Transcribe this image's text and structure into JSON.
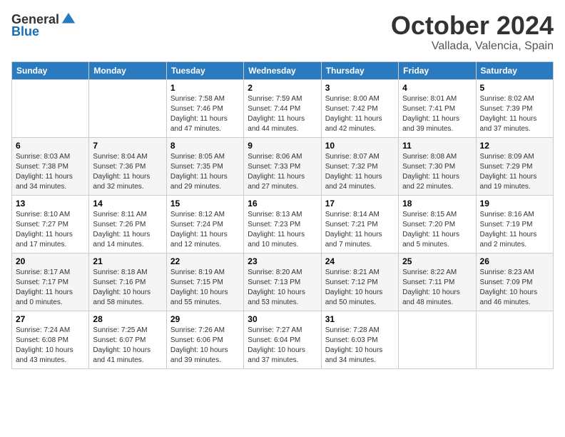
{
  "header": {
    "logo_general": "General",
    "logo_blue": "Blue",
    "month": "October 2024",
    "location": "Vallada, Valencia, Spain"
  },
  "days_of_week": [
    "Sunday",
    "Monday",
    "Tuesday",
    "Wednesday",
    "Thursday",
    "Friday",
    "Saturday"
  ],
  "weeks": [
    [
      {
        "day": "",
        "info": ""
      },
      {
        "day": "",
        "info": ""
      },
      {
        "day": "1",
        "info": "Sunrise: 7:58 AM\nSunset: 7:46 PM\nDaylight: 11 hours and 47 minutes."
      },
      {
        "day": "2",
        "info": "Sunrise: 7:59 AM\nSunset: 7:44 PM\nDaylight: 11 hours and 44 minutes."
      },
      {
        "day": "3",
        "info": "Sunrise: 8:00 AM\nSunset: 7:42 PM\nDaylight: 11 hours and 42 minutes."
      },
      {
        "day": "4",
        "info": "Sunrise: 8:01 AM\nSunset: 7:41 PM\nDaylight: 11 hours and 39 minutes."
      },
      {
        "day": "5",
        "info": "Sunrise: 8:02 AM\nSunset: 7:39 PM\nDaylight: 11 hours and 37 minutes."
      }
    ],
    [
      {
        "day": "6",
        "info": "Sunrise: 8:03 AM\nSunset: 7:38 PM\nDaylight: 11 hours and 34 minutes."
      },
      {
        "day": "7",
        "info": "Sunrise: 8:04 AM\nSunset: 7:36 PM\nDaylight: 11 hours and 32 minutes."
      },
      {
        "day": "8",
        "info": "Sunrise: 8:05 AM\nSunset: 7:35 PM\nDaylight: 11 hours and 29 minutes."
      },
      {
        "day": "9",
        "info": "Sunrise: 8:06 AM\nSunset: 7:33 PM\nDaylight: 11 hours and 27 minutes."
      },
      {
        "day": "10",
        "info": "Sunrise: 8:07 AM\nSunset: 7:32 PM\nDaylight: 11 hours and 24 minutes."
      },
      {
        "day": "11",
        "info": "Sunrise: 8:08 AM\nSunset: 7:30 PM\nDaylight: 11 hours and 22 minutes."
      },
      {
        "day": "12",
        "info": "Sunrise: 8:09 AM\nSunset: 7:29 PM\nDaylight: 11 hours and 19 minutes."
      }
    ],
    [
      {
        "day": "13",
        "info": "Sunrise: 8:10 AM\nSunset: 7:27 PM\nDaylight: 11 hours and 17 minutes."
      },
      {
        "day": "14",
        "info": "Sunrise: 8:11 AM\nSunset: 7:26 PM\nDaylight: 11 hours and 14 minutes."
      },
      {
        "day": "15",
        "info": "Sunrise: 8:12 AM\nSunset: 7:24 PM\nDaylight: 11 hours and 12 minutes."
      },
      {
        "day": "16",
        "info": "Sunrise: 8:13 AM\nSunset: 7:23 PM\nDaylight: 11 hours and 10 minutes."
      },
      {
        "day": "17",
        "info": "Sunrise: 8:14 AM\nSunset: 7:21 PM\nDaylight: 11 hours and 7 minutes."
      },
      {
        "day": "18",
        "info": "Sunrise: 8:15 AM\nSunset: 7:20 PM\nDaylight: 11 hours and 5 minutes."
      },
      {
        "day": "19",
        "info": "Sunrise: 8:16 AM\nSunset: 7:19 PM\nDaylight: 11 hours and 2 minutes."
      }
    ],
    [
      {
        "day": "20",
        "info": "Sunrise: 8:17 AM\nSunset: 7:17 PM\nDaylight: 11 hours and 0 minutes."
      },
      {
        "day": "21",
        "info": "Sunrise: 8:18 AM\nSunset: 7:16 PM\nDaylight: 10 hours and 58 minutes."
      },
      {
        "day": "22",
        "info": "Sunrise: 8:19 AM\nSunset: 7:15 PM\nDaylight: 10 hours and 55 minutes."
      },
      {
        "day": "23",
        "info": "Sunrise: 8:20 AM\nSunset: 7:13 PM\nDaylight: 10 hours and 53 minutes."
      },
      {
        "day": "24",
        "info": "Sunrise: 8:21 AM\nSunset: 7:12 PM\nDaylight: 10 hours and 50 minutes."
      },
      {
        "day": "25",
        "info": "Sunrise: 8:22 AM\nSunset: 7:11 PM\nDaylight: 10 hours and 48 minutes."
      },
      {
        "day": "26",
        "info": "Sunrise: 8:23 AM\nSunset: 7:09 PM\nDaylight: 10 hours and 46 minutes."
      }
    ],
    [
      {
        "day": "27",
        "info": "Sunrise: 7:24 AM\nSunset: 6:08 PM\nDaylight: 10 hours and 43 minutes."
      },
      {
        "day": "28",
        "info": "Sunrise: 7:25 AM\nSunset: 6:07 PM\nDaylight: 10 hours and 41 minutes."
      },
      {
        "day": "29",
        "info": "Sunrise: 7:26 AM\nSunset: 6:06 PM\nDaylight: 10 hours and 39 minutes."
      },
      {
        "day": "30",
        "info": "Sunrise: 7:27 AM\nSunset: 6:04 PM\nDaylight: 10 hours and 37 minutes."
      },
      {
        "day": "31",
        "info": "Sunrise: 7:28 AM\nSunset: 6:03 PM\nDaylight: 10 hours and 34 minutes."
      },
      {
        "day": "",
        "info": ""
      },
      {
        "day": "",
        "info": ""
      }
    ]
  ]
}
